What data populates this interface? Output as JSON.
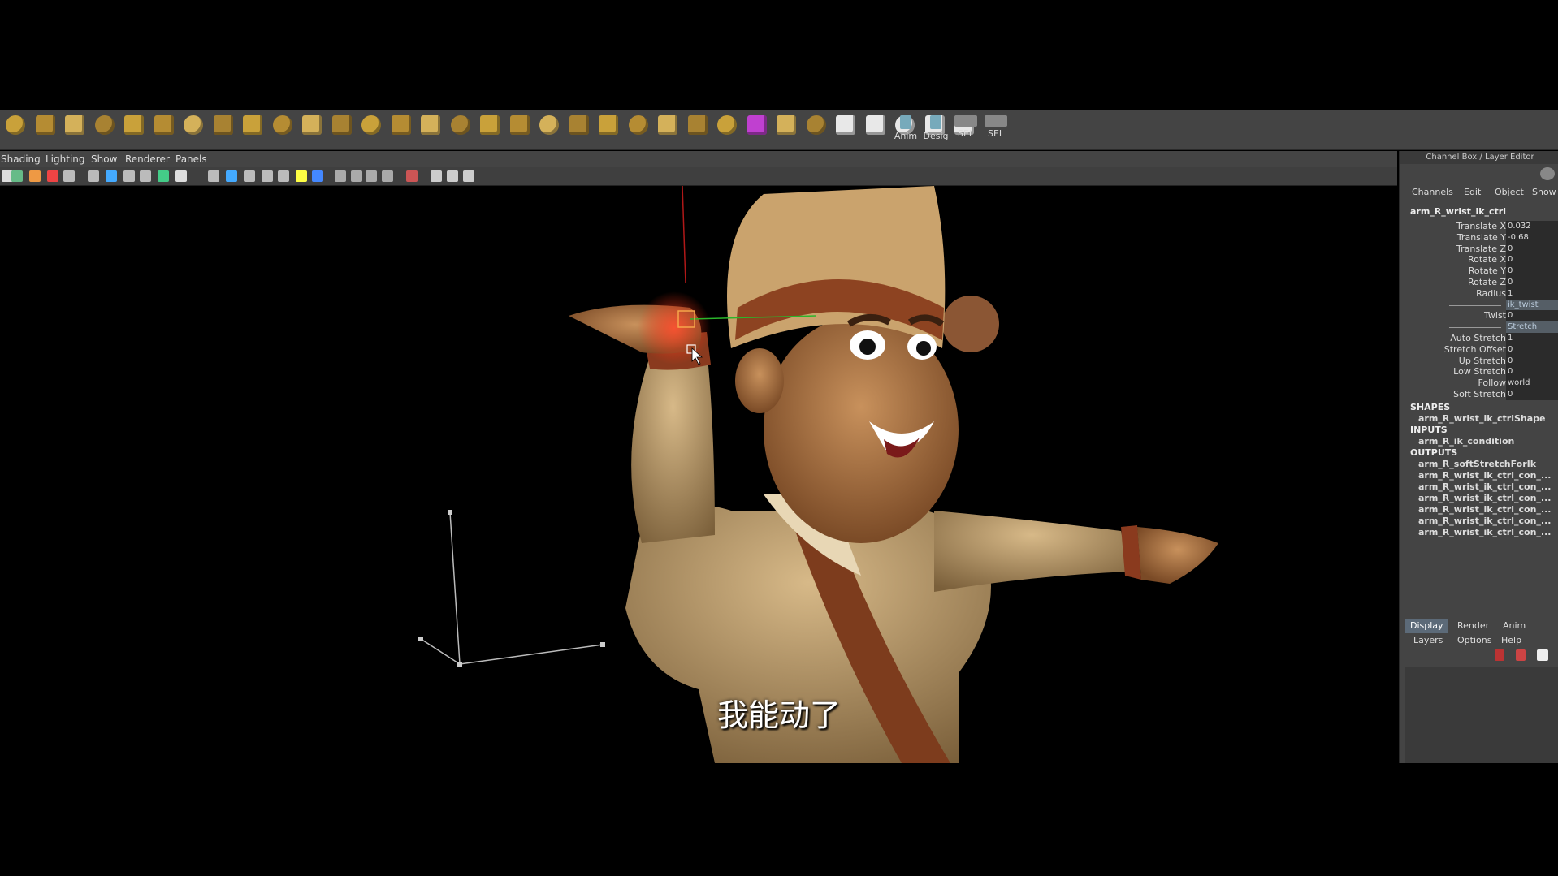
{
  "shelf": {
    "icons": [
      "poly-sphere-icon",
      "poly-cube-icon",
      "poly-cylinder-icon",
      "poly-cone-icon",
      "poly-plane-icon",
      "poly-torus-icon",
      "poly-pyramid-icon",
      "poly-pipe-icon",
      "poly-helix-icon",
      "extrude-icon",
      "bevel-icon",
      "bridge-icon",
      "boolean-icon",
      "smooth-icon",
      "combine-icon",
      "separate-icon",
      "mirror-icon",
      "split-icon",
      "merge-icon",
      "fill-hole-icon",
      "wedge-icon",
      "poke-icon",
      "append-icon",
      "collapse-icon",
      "extract-icon",
      "crease-icon",
      "duplicate-icon",
      "sculpt-icon",
      "checker-icon",
      "uv-layout-icon",
      "uv-unfold-icon",
      "gear-icon",
      "texture-icon"
    ],
    "anim_label": "Anim",
    "design_label": "Desig",
    "sel1_label": "SEL",
    "sel2_label": "SEL"
  },
  "viewport_menu": [
    "Shading",
    "Lighting",
    "Show",
    "Renderer",
    "Panels"
  ],
  "subtitle": "我能动了",
  "channel_box": {
    "title": "Channel Box / Layer Editor",
    "menu": [
      "Channels",
      "Edit",
      "Object",
      "Show"
    ],
    "node": "arm_R_wrist_ik_ctrl",
    "channels": [
      {
        "name": "Translate X",
        "value": "0.032"
      },
      {
        "name": "Translate Y",
        "value": "-0.68"
      },
      {
        "name": "Translate Z",
        "value": "0"
      },
      {
        "name": "Rotate X",
        "value": "0"
      },
      {
        "name": "Rotate Y",
        "value": "0"
      },
      {
        "name": "Rotate Z",
        "value": "0"
      },
      {
        "name": "Radius",
        "value": "1"
      },
      {
        "name": "",
        "value": "ik_twist"
      },
      {
        "name": "Twist",
        "value": "0"
      },
      {
        "name": "",
        "value": "Stretch"
      },
      {
        "name": "Auto Stretch",
        "value": "1"
      },
      {
        "name": "Stretch Offset",
        "value": "0"
      },
      {
        "name": "Up Stretch",
        "value": "0"
      },
      {
        "name": "Low Stretch",
        "value": "0"
      },
      {
        "name": "Follow",
        "value": "world"
      },
      {
        "name": "Soft Stretch",
        "value": "0"
      }
    ],
    "shapes_label": "SHAPES",
    "shapes": [
      "arm_R_wrist_ik_ctrlShape"
    ],
    "inputs_label": "INPUTS",
    "inputs": [
      "arm_R_ik_condition"
    ],
    "outputs_label": "OUTPUTS",
    "outputs": [
      "arm_R_softStretchForIk",
      "arm_R_wrist_ik_ctrl_con_...",
      "arm_R_wrist_ik_ctrl_con_...",
      "arm_R_wrist_ik_ctrl_con_...",
      "arm_R_wrist_ik_ctrl_con_...",
      "arm_R_wrist_ik_ctrl_con_...",
      "arm_R_wrist_ik_ctrl_con_..."
    ]
  },
  "layer_editor": {
    "tabs": [
      "Display",
      "Render",
      "Anim"
    ],
    "menu": [
      "Layers",
      "Options",
      "Help"
    ]
  },
  "colors": {
    "accent": "#c9a13a",
    "tab_active": "#5c6a78",
    "viewport_bg": "#000000"
  }
}
